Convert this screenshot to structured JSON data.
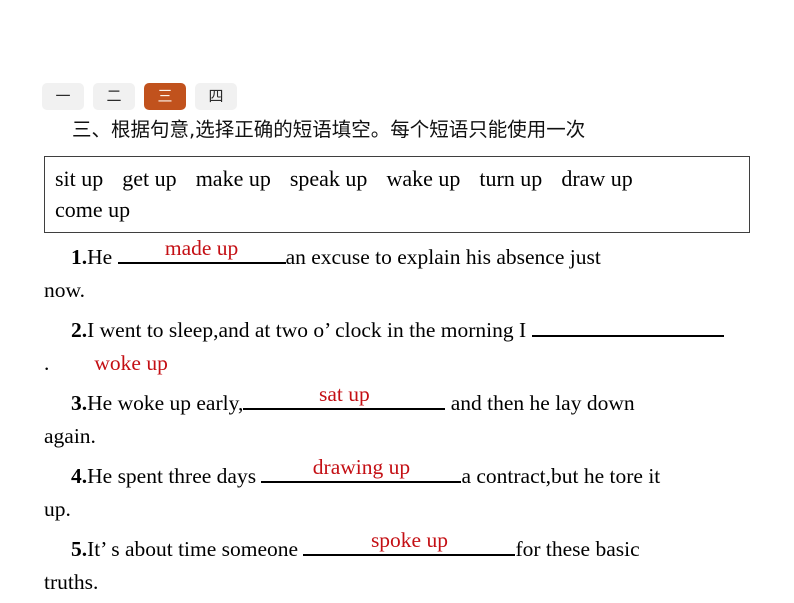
{
  "tabs": [
    {
      "label": "一",
      "active": false,
      "name": "tab-one"
    },
    {
      "label": "二",
      "active": false,
      "name": "tab-two"
    },
    {
      "label": "三",
      "active": true,
      "name": "tab-three"
    },
    {
      "label": "四",
      "active": false,
      "name": "tab-four"
    }
  ],
  "colors": {
    "active_tab_bg": "#c1521d",
    "active_tab_fg": "#fdf3ea",
    "inactive_tab_bg": "#f1f1f1",
    "answer_red": "#c40f14",
    "box_border": "#3f3f3f",
    "page_bg": "#ffffff"
  },
  "heading": "三、根据句意,选择正确的短语填空。每个短语只能使用一次",
  "phrase_box": {
    "phrases": [
      "sit up",
      "get up",
      "make up",
      "speak up",
      "wake up",
      "turn up",
      "draw up",
      "come up"
    ]
  },
  "questions": [
    {
      "number": "1.",
      "before": "He ",
      "answer": "made up",
      "after": "an excuse to explain his absence just",
      "wrap": "now."
    },
    {
      "number": "2.",
      "before": "I went to sleep,and at two o’ clock in the morning I ",
      "answer": "woke up",
      "after": "",
      "wrap": "."
    },
    {
      "number": "3.",
      "before": "He woke up early,",
      "answer": "sat up",
      "after": " and then he lay down",
      "wrap": "again."
    },
    {
      "number": "4.",
      "before": "He spent three days ",
      "answer": "drawing up",
      "after": "a contract,but he tore it",
      "wrap": "up."
    },
    {
      "number": "5.",
      "before": "It’ s about time someone ",
      "answer": "spoke up",
      "after": "for these basic",
      "wrap": "truths."
    }
  ]
}
